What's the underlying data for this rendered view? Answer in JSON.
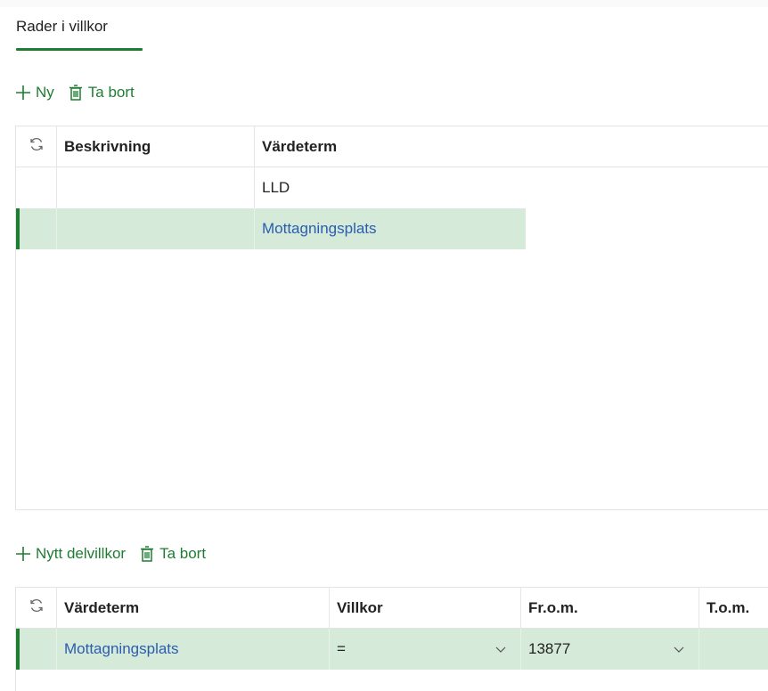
{
  "tab": {
    "label": "Rader i villkor"
  },
  "toolbar1": {
    "new_label": "Ny",
    "delete_label": "Ta bort"
  },
  "grid1": {
    "headers": {
      "description": "Beskrivning",
      "value_term": "Värdeterm"
    },
    "rows": [
      {
        "description": "",
        "value_term": "LLD"
      },
      {
        "description": "",
        "value_term": "Mottagningsplats"
      }
    ]
  },
  "toolbar2": {
    "new_label": "Nytt delvillkor",
    "delete_label": "Ta bort"
  },
  "grid2": {
    "headers": {
      "value_term": "Värdeterm",
      "condition": "Villkor",
      "from": "Fr.o.m.",
      "to": "T.o.m."
    },
    "rows": [
      {
        "value_term": "Mottagningsplats",
        "condition": "=",
        "from": "13877",
        "to": ""
      }
    ]
  },
  "colors": {
    "accent": "#1e7d32",
    "selected_row": "#d5ead8",
    "link": "#2a5db0"
  },
  "icons": [
    "plus-icon",
    "trash-icon",
    "refresh-icon",
    "chevron-down-icon"
  ]
}
